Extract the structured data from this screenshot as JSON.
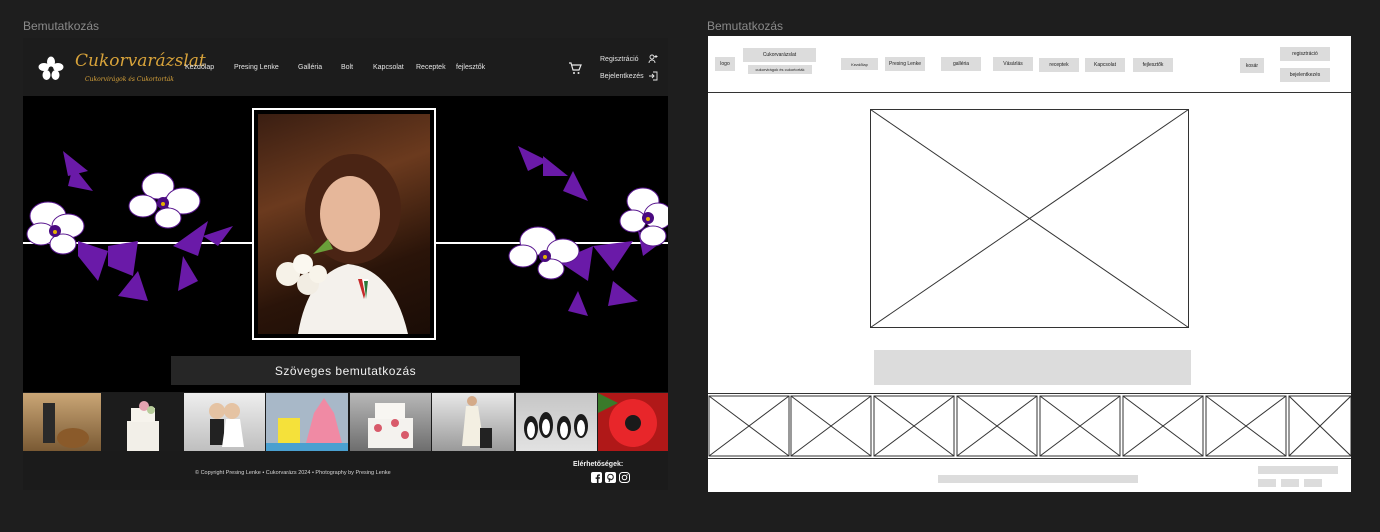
{
  "frames": {
    "left_label": "Bemutatkozás",
    "right_label": "Bemutatkozás"
  },
  "design": {
    "brand": {
      "title": "Cukorvarázslat",
      "subtitle": "Cukorvirágok és Cukortorták",
      "logo_icon": "orchid-flower-icon"
    },
    "nav": [
      "Kezdőlap",
      "Presing Lenke",
      "Galléria",
      "Bolt",
      "Kapcsolat",
      "Receptek",
      "fejlesztők"
    ],
    "cart_icon": "shopping-cart-icon",
    "account": {
      "register": "Regisztráció",
      "login": "Bejelentkezés"
    },
    "hero": {
      "caption": "Szöveges bemutatkozás",
      "accent_color": "#6a1aa8"
    },
    "gallery_items": [
      "dog-with-person",
      "white-cake-roses",
      "wedding-cake-topper",
      "spongebob-patrick-cake",
      "rose-tiered-cake",
      "wedding-couple-figure",
      "penguin-figures",
      "red-poppy-flower"
    ],
    "footer": {
      "copyright": "© Copyright Presing Lenke • Cukorvarázs 2024 • Photography by Presing Lenke",
      "contact_title": "Elérhetőségek:",
      "social_icons": [
        "facebook-icon",
        "pinterest-icon",
        "instagram-icon"
      ]
    }
  },
  "wireframe": {
    "logo": "logo",
    "title": "Cukorvarázslat",
    "subtitle": "cukorvirágok és cukortorták",
    "nav": [
      "Kezdőlap",
      "Presing Lenke",
      "galléria",
      "Vásárlás",
      "receptek",
      "Kapcsolat",
      "fejlesztők"
    ],
    "cart": "kosár",
    "register": "regisztráció",
    "login": "bejelentkezés"
  }
}
